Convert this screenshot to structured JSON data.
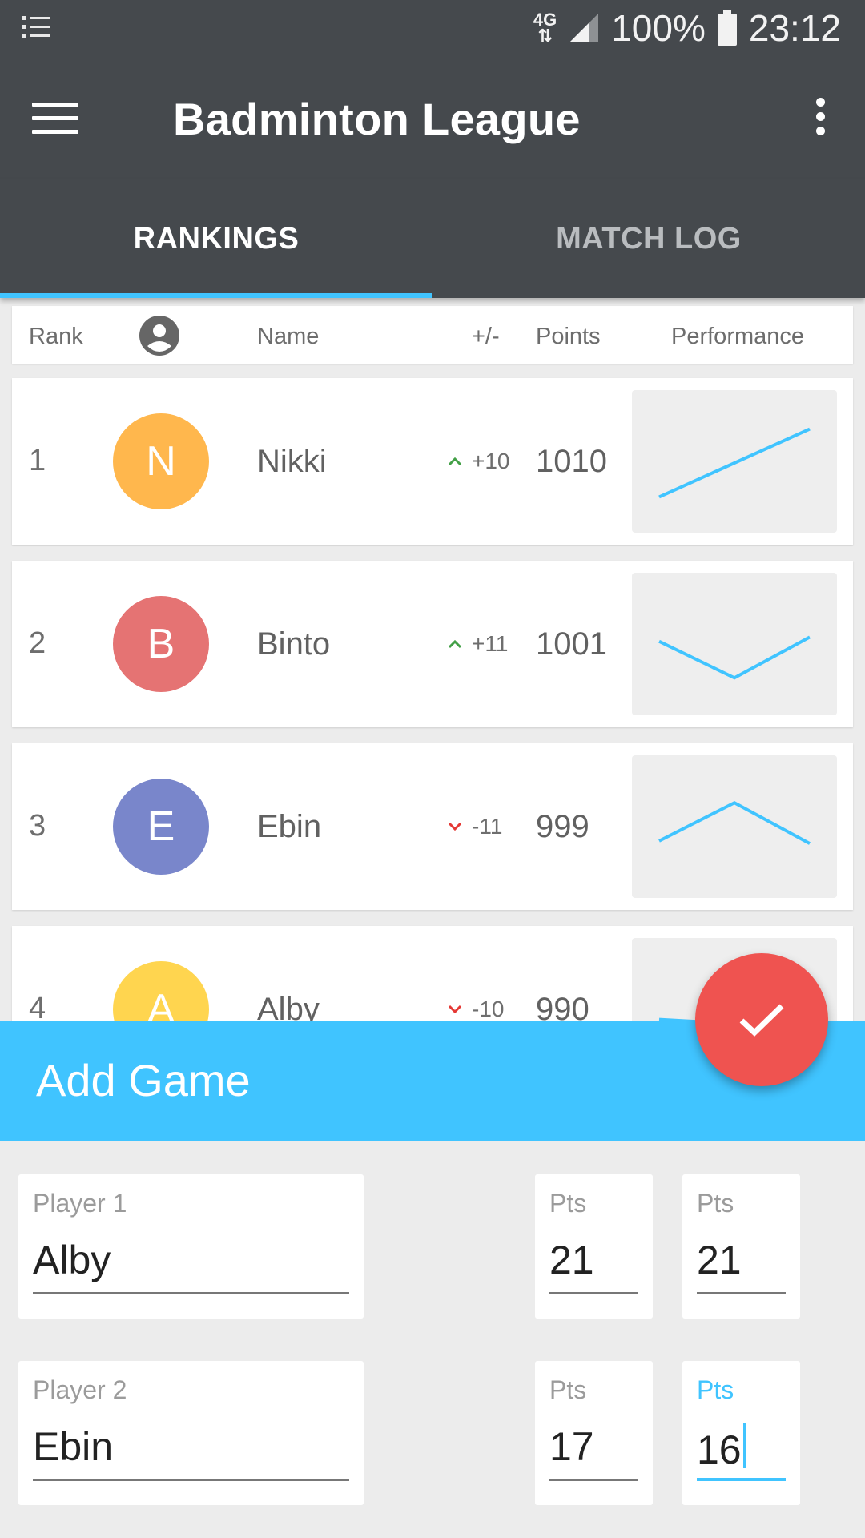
{
  "status_bar": {
    "network": "4G",
    "battery": "100%",
    "time": "23:12"
  },
  "toolbar": {
    "title": "Badminton League"
  },
  "tabs": [
    {
      "label": "RANKINGS",
      "active": true
    },
    {
      "label": "MATCH LOG",
      "active": false
    }
  ],
  "table_header": {
    "rank": "Rank",
    "name": "Name",
    "delta": "+/-",
    "points": "Points",
    "performance": "Performance"
  },
  "players": [
    {
      "rank": "1",
      "initial": "N",
      "name": "Nikki",
      "delta": "+10",
      "trend": "up",
      "points": "1010",
      "avatar_color": "#ffb74d",
      "performance": [
        0.1,
        0.9
      ]
    },
    {
      "rank": "2",
      "initial": "B",
      "name": "Binto",
      "delta": "+11",
      "trend": "up",
      "points": "1001",
      "avatar_color": "#e57373",
      "performance": [
        0.55,
        0.12,
        0.6
      ]
    },
    {
      "rank": "3",
      "initial": "E",
      "name": "Ebin",
      "delta": "-11",
      "trend": "down",
      "points": "999",
      "avatar_color": "#7986cb",
      "performance": [
        0.35,
        0.8,
        0.32
      ]
    },
    {
      "rank": "4",
      "initial": "A",
      "name": "Alby",
      "delta": "-10",
      "trend": "down",
      "points": "990",
      "avatar_color": "#ffd54f",
      "performance": [
        0.4,
        0.3
      ]
    }
  ],
  "add_game": {
    "title": "Add Game",
    "player1_label": "Player 1",
    "player1_value": "Alby",
    "player2_label": "Player 2",
    "player2_value": "Ebin",
    "pts_label": "Pts",
    "p1_game1": "21",
    "p1_game2": "21",
    "p2_game1": "17",
    "p2_game2": "16"
  },
  "colors": {
    "bar": "#45494d",
    "accent": "#40c4ff",
    "fab": "#ef5350",
    "up": "#43a047",
    "down": "#e53935",
    "sparkline": "#40c4ff"
  }
}
